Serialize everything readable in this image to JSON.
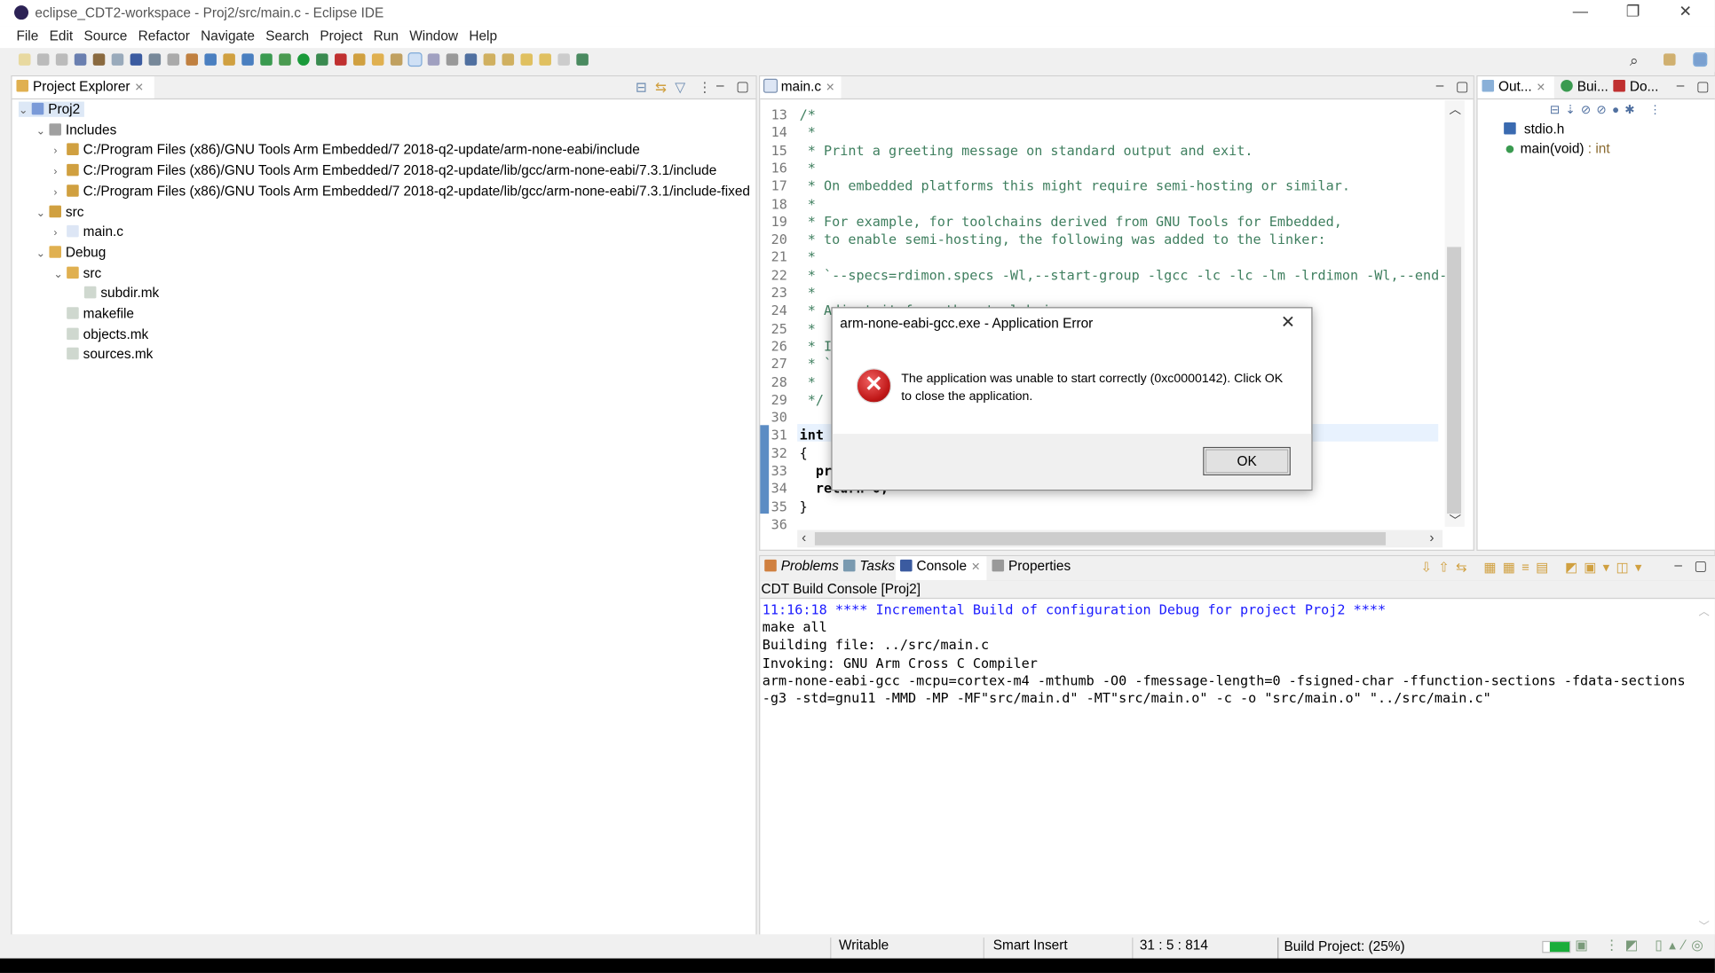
{
  "window": {
    "title": "eclipse_CDT2-workspace - Proj2/src/main.c - Eclipse IDE",
    "minimize": "—",
    "restore": "❐",
    "close": "✕"
  },
  "menu": [
    "File",
    "Edit",
    "Source",
    "Refactor",
    "Navigate",
    "Search",
    "Project",
    "Run",
    "Window",
    "Help"
  ],
  "project_explorer": {
    "tab": "Project Explorer",
    "items": [
      {
        "label": "Proj2",
        "level": 0,
        "expanded": true,
        "icon": "project-icon"
      },
      {
        "label": "Includes",
        "level": 1,
        "expanded": true,
        "icon": "includes-icon"
      },
      {
        "label": "C:/Program Files (x86)/GNU Tools Arm Embedded/7 2018-q2-update/arm-none-eabi/include",
        "level": 2,
        "expanded": false,
        "icon": "include-folder-icon"
      },
      {
        "label": "C:/Program Files (x86)/GNU Tools Arm Embedded/7 2018-q2-update/lib/gcc/arm-none-eabi/7.3.1/include",
        "level": 2,
        "expanded": false,
        "icon": "include-folder-icon"
      },
      {
        "label": "C:/Program Files (x86)/GNU Tools Arm Embedded/7 2018-q2-update/lib/gcc/arm-none-eabi/7.3.1/include-fixed",
        "level": 2,
        "expanded": false,
        "icon": "include-folder-icon"
      },
      {
        "label": "src",
        "level": 1,
        "expanded": true,
        "icon": "source-folder-icon"
      },
      {
        "label": "main.c",
        "level": 2,
        "expanded": false,
        "icon": "c-file-icon"
      },
      {
        "label": "Debug",
        "level": 1,
        "expanded": true,
        "icon": "folder-icon"
      },
      {
        "label": "src",
        "level": 2,
        "expanded": true,
        "icon": "folder-icon"
      },
      {
        "label": "subdir.mk",
        "level": 3,
        "icon": "file-icon"
      },
      {
        "label": "makefile",
        "level": 2,
        "icon": "file-icon"
      },
      {
        "label": "objects.mk",
        "level": 2,
        "icon": "file-icon"
      },
      {
        "label": "sources.mk",
        "level": 2,
        "icon": "file-icon"
      }
    ]
  },
  "editor": {
    "tab": "main.c",
    "lines": [
      {
        "n": "13",
        "t": "/*"
      },
      {
        "n": "14",
        "t": " *"
      },
      {
        "n": "15",
        "t": " * Print a greeting message on standard output and exit."
      },
      {
        "n": "16",
        "t": " *"
      },
      {
        "n": "17",
        "t": " * On embedded platforms this might require semi-hosting or similar."
      },
      {
        "n": "18",
        "t": " *"
      },
      {
        "n": "19",
        "t": " * For example, for toolchains derived from GNU Tools for Embedded,"
      },
      {
        "n": "20",
        "t": " * to enable semi-hosting, the following was added to the linker:"
      },
      {
        "n": "21",
        "t": " *"
      },
      {
        "n": "22",
        "t": " * `--specs=rdimon.specs -Wl,--start-group -lgcc -lc -lc -lm -lrdimon -Wl,--end-g"
      },
      {
        "n": "23",
        "t": " *"
      },
      {
        "n": "24",
        "t": " * Adjust it for other toolchains."
      },
      {
        "n": "25",
        "t": " *"
      },
      {
        "n": "26",
        "t": " * I"
      },
      {
        "n": "27",
        "t": " * `"
      },
      {
        "n": "28",
        "t": " *"
      },
      {
        "n": "29",
        "t": " */"
      },
      {
        "n": "30",
        "t": ""
      },
      {
        "n": "31",
        "t": "int m"
      },
      {
        "n": "32",
        "t": "{"
      },
      {
        "n": "33",
        "t": "  pr"
      },
      {
        "n": "34",
        "t": "  return 0;"
      },
      {
        "n": "35",
        "t": "}"
      },
      {
        "n": "36",
        "t": ""
      }
    ]
  },
  "outline": {
    "tabs": [
      "Out...",
      "Bui...",
      "Do..."
    ],
    "items": [
      {
        "label": "stdio.h",
        "suffix": ""
      },
      {
        "label": "main(void)",
        "suffix": " : int"
      }
    ]
  },
  "console": {
    "tabs": [
      "Problems",
      "Tasks",
      "Console",
      "Properties"
    ],
    "header": "CDT Build Console [Proj2]",
    "lines": [
      "11:16:18 **** Incremental Build of configuration Debug for project Proj2 ****",
      "make all",
      "Building file: ../src/main.c",
      "Invoking: GNU Arm Cross C Compiler",
      "arm-none-eabi-gcc -mcpu=cortex-m4 -mthumb -O0 -fmessage-length=0 -fsigned-char -ffunction-sections -fdata-sections",
      "-g3 -std=gnu11 -MMD -MP -MF\"src/main.d\" -MT\"src/main.o\" -c -o \"src/main.o\" \"../src/main.c\""
    ],
    "info_color": "#1a1aff"
  },
  "status": {
    "writable": "Writable",
    "insert": "Smart Insert",
    "position": "31 : 5 : 814",
    "progress_label": "Build Project: (25%)",
    "progress": 25
  },
  "dialog": {
    "title": "arm-none-eabi-gcc.exe - Application Error",
    "message": "The application was unable to start correctly (0xc0000142). Click OK to close the application.",
    "ok": "OK",
    "close": "✕",
    "icon": "error-icon"
  }
}
